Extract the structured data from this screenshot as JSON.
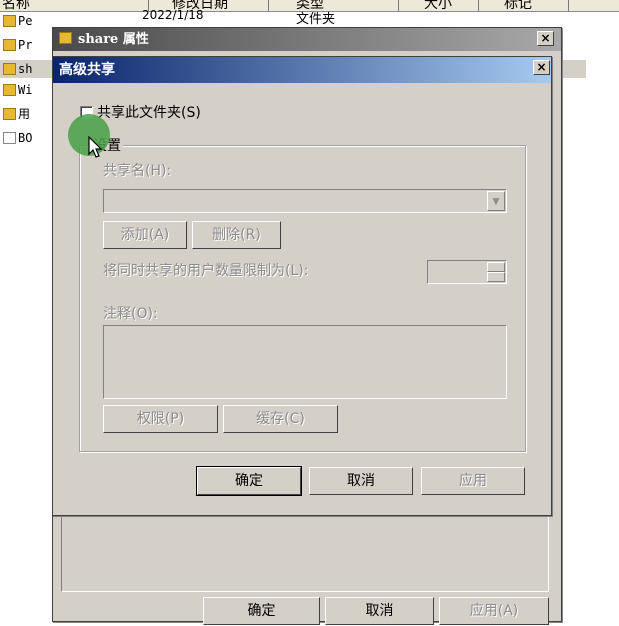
{
  "explorer": {
    "columns": [
      "名称",
      "修改日期",
      "类型",
      "大小",
      "标记"
    ],
    "rows": [
      {
        "name": "Pe",
        "icon": "folder-icon",
        "date": "2022/1/18",
        "type": "文件夹"
      },
      {
        "name": "Pr",
        "icon": "folder-icon"
      },
      {
        "name": "sh",
        "icon": "folder-icon",
        "selected": true
      },
      {
        "name": "Wi",
        "icon": "folder-icon"
      },
      {
        "name": "用",
        "icon": "folder-icon"
      },
      {
        "name": "BO",
        "icon": "document-icon"
      }
    ]
  },
  "properties_dialog": {
    "title": "share 属性",
    "close": "×",
    "ok": "确定",
    "cancel": "取消",
    "apply": "应用(A)"
  },
  "advanced_dialog": {
    "title": "高级共享",
    "close": "×",
    "share_checkbox_label": "共享此文件夹(S)",
    "settings_legend": "设置",
    "share_name_label": "共享名(H):",
    "share_name_value": "",
    "add_button": "添加(A)",
    "remove_button": "删除(R)",
    "limit_label": "将同时共享的用户数量限制为(L):",
    "limit_value": "",
    "comment_label": "注释(O):",
    "comment_value": "",
    "permissions_button": "权限(P)",
    "caching_button": "缓存(C)",
    "ok": "确定",
    "cancel": "取消",
    "apply": "应用"
  },
  "colors": {
    "titlebar_active_start": "#0a246a",
    "titlebar_active_end": "#a6caf0",
    "dialog_face": "#d4d0c8",
    "click_indicator": "#46a046"
  }
}
